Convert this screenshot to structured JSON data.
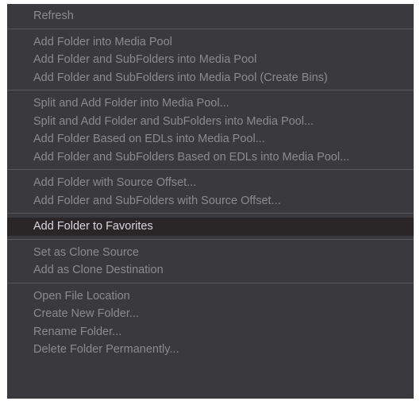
{
  "context_menu": {
    "groups": [
      {
        "items": [
          {
            "label": "Refresh"
          }
        ]
      },
      {
        "items": [
          {
            "label": "Add Folder into Media Pool"
          },
          {
            "label": "Add Folder and SubFolders into Media Pool"
          },
          {
            "label": "Add Folder and SubFolders into Media Pool (Create Bins)"
          }
        ]
      },
      {
        "items": [
          {
            "label": "Split and Add Folder into Media Pool..."
          },
          {
            "label": "Split and Add Folder and SubFolders into Media Pool..."
          },
          {
            "label": "Add Folder Based on EDLs into Media Pool..."
          },
          {
            "label": "Add Folder and SubFolders Based on EDLs into Media Pool..."
          }
        ]
      },
      {
        "items": [
          {
            "label": "Add Folder with Source Offset..."
          },
          {
            "label": "Add Folder and SubFolders with Source Offset..."
          }
        ]
      },
      {
        "items": [
          {
            "label": "Add Folder to Favorites",
            "highlighted": true
          }
        ]
      },
      {
        "items": [
          {
            "label": "Set as Clone Source"
          },
          {
            "label": "Add as Clone Destination"
          }
        ]
      },
      {
        "items": [
          {
            "label": "Open File Location"
          },
          {
            "label": "Create New Folder..."
          },
          {
            "label": "Rename Folder..."
          },
          {
            "label": "Delete Folder Permanently..."
          }
        ]
      }
    ]
  },
  "colors": {
    "menu_background": "#3a3a3e",
    "item_text": "#8a8a8f",
    "highlight_background": "#2a2527",
    "highlight_text": "#d8d8dc",
    "separator": "#5a5a5e"
  }
}
